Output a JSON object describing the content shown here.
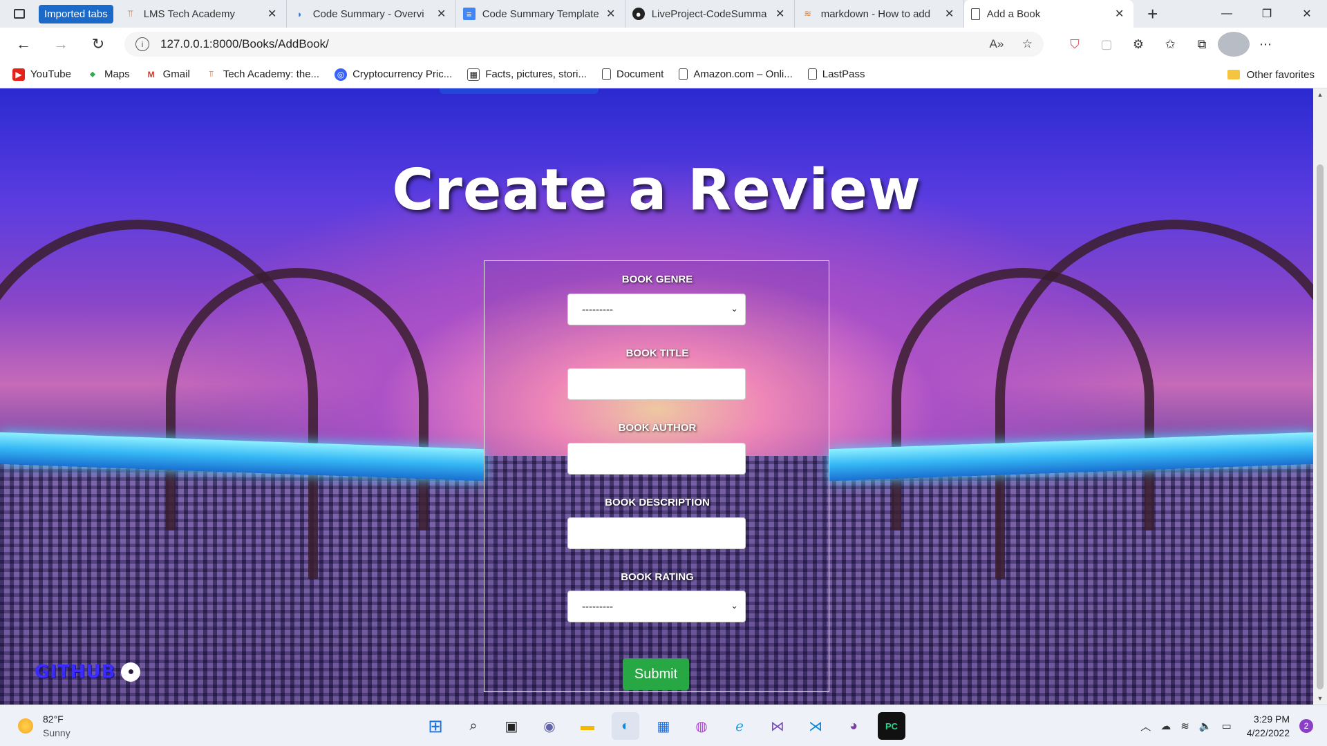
{
  "browser": {
    "tab_group": "Imported tabs",
    "tabs": [
      {
        "label": "LMS Tech Academy"
      },
      {
        "label": "Code Summary - Overvi"
      },
      {
        "label": "Code Summary Template"
      },
      {
        "label": "LiveProject-CodeSumma"
      },
      {
        "label": "markdown - How to add"
      },
      {
        "label": "Add a Book"
      }
    ],
    "new_tab": "+",
    "url": "127.0.0.1:8000/Books/AddBook/"
  },
  "bookmarks": {
    "items": [
      {
        "label": "YouTube"
      },
      {
        "label": "Maps"
      },
      {
        "label": "Gmail"
      },
      {
        "label": "Tech Academy: the..."
      },
      {
        "label": "Cryptocurrency Pric..."
      },
      {
        "label": "Facts, pictures, stori..."
      },
      {
        "label": "Document"
      },
      {
        "label": "Amazon.com – Onli..."
      },
      {
        "label": "LastPass"
      }
    ],
    "other": "Other favorites"
  },
  "page": {
    "title": "Create a Review",
    "form": {
      "genre_label": "BOOK GENRE",
      "genre_value": "---------",
      "title_label": "BOOK TITLE",
      "title_value": "",
      "author_label": "BOOK AUTHOR",
      "author_value": "",
      "description_label": "BOOK DESCRIPTION",
      "description_value": "",
      "rating_label": "BOOK RATING",
      "rating_value": "---------",
      "submit": "Submit"
    },
    "github_label": "GITHUB"
  },
  "taskbar": {
    "temperature": "82°F",
    "condition": "Sunny",
    "time": "3:29 PM",
    "date": "4/22/2022",
    "notifications": "2"
  }
}
